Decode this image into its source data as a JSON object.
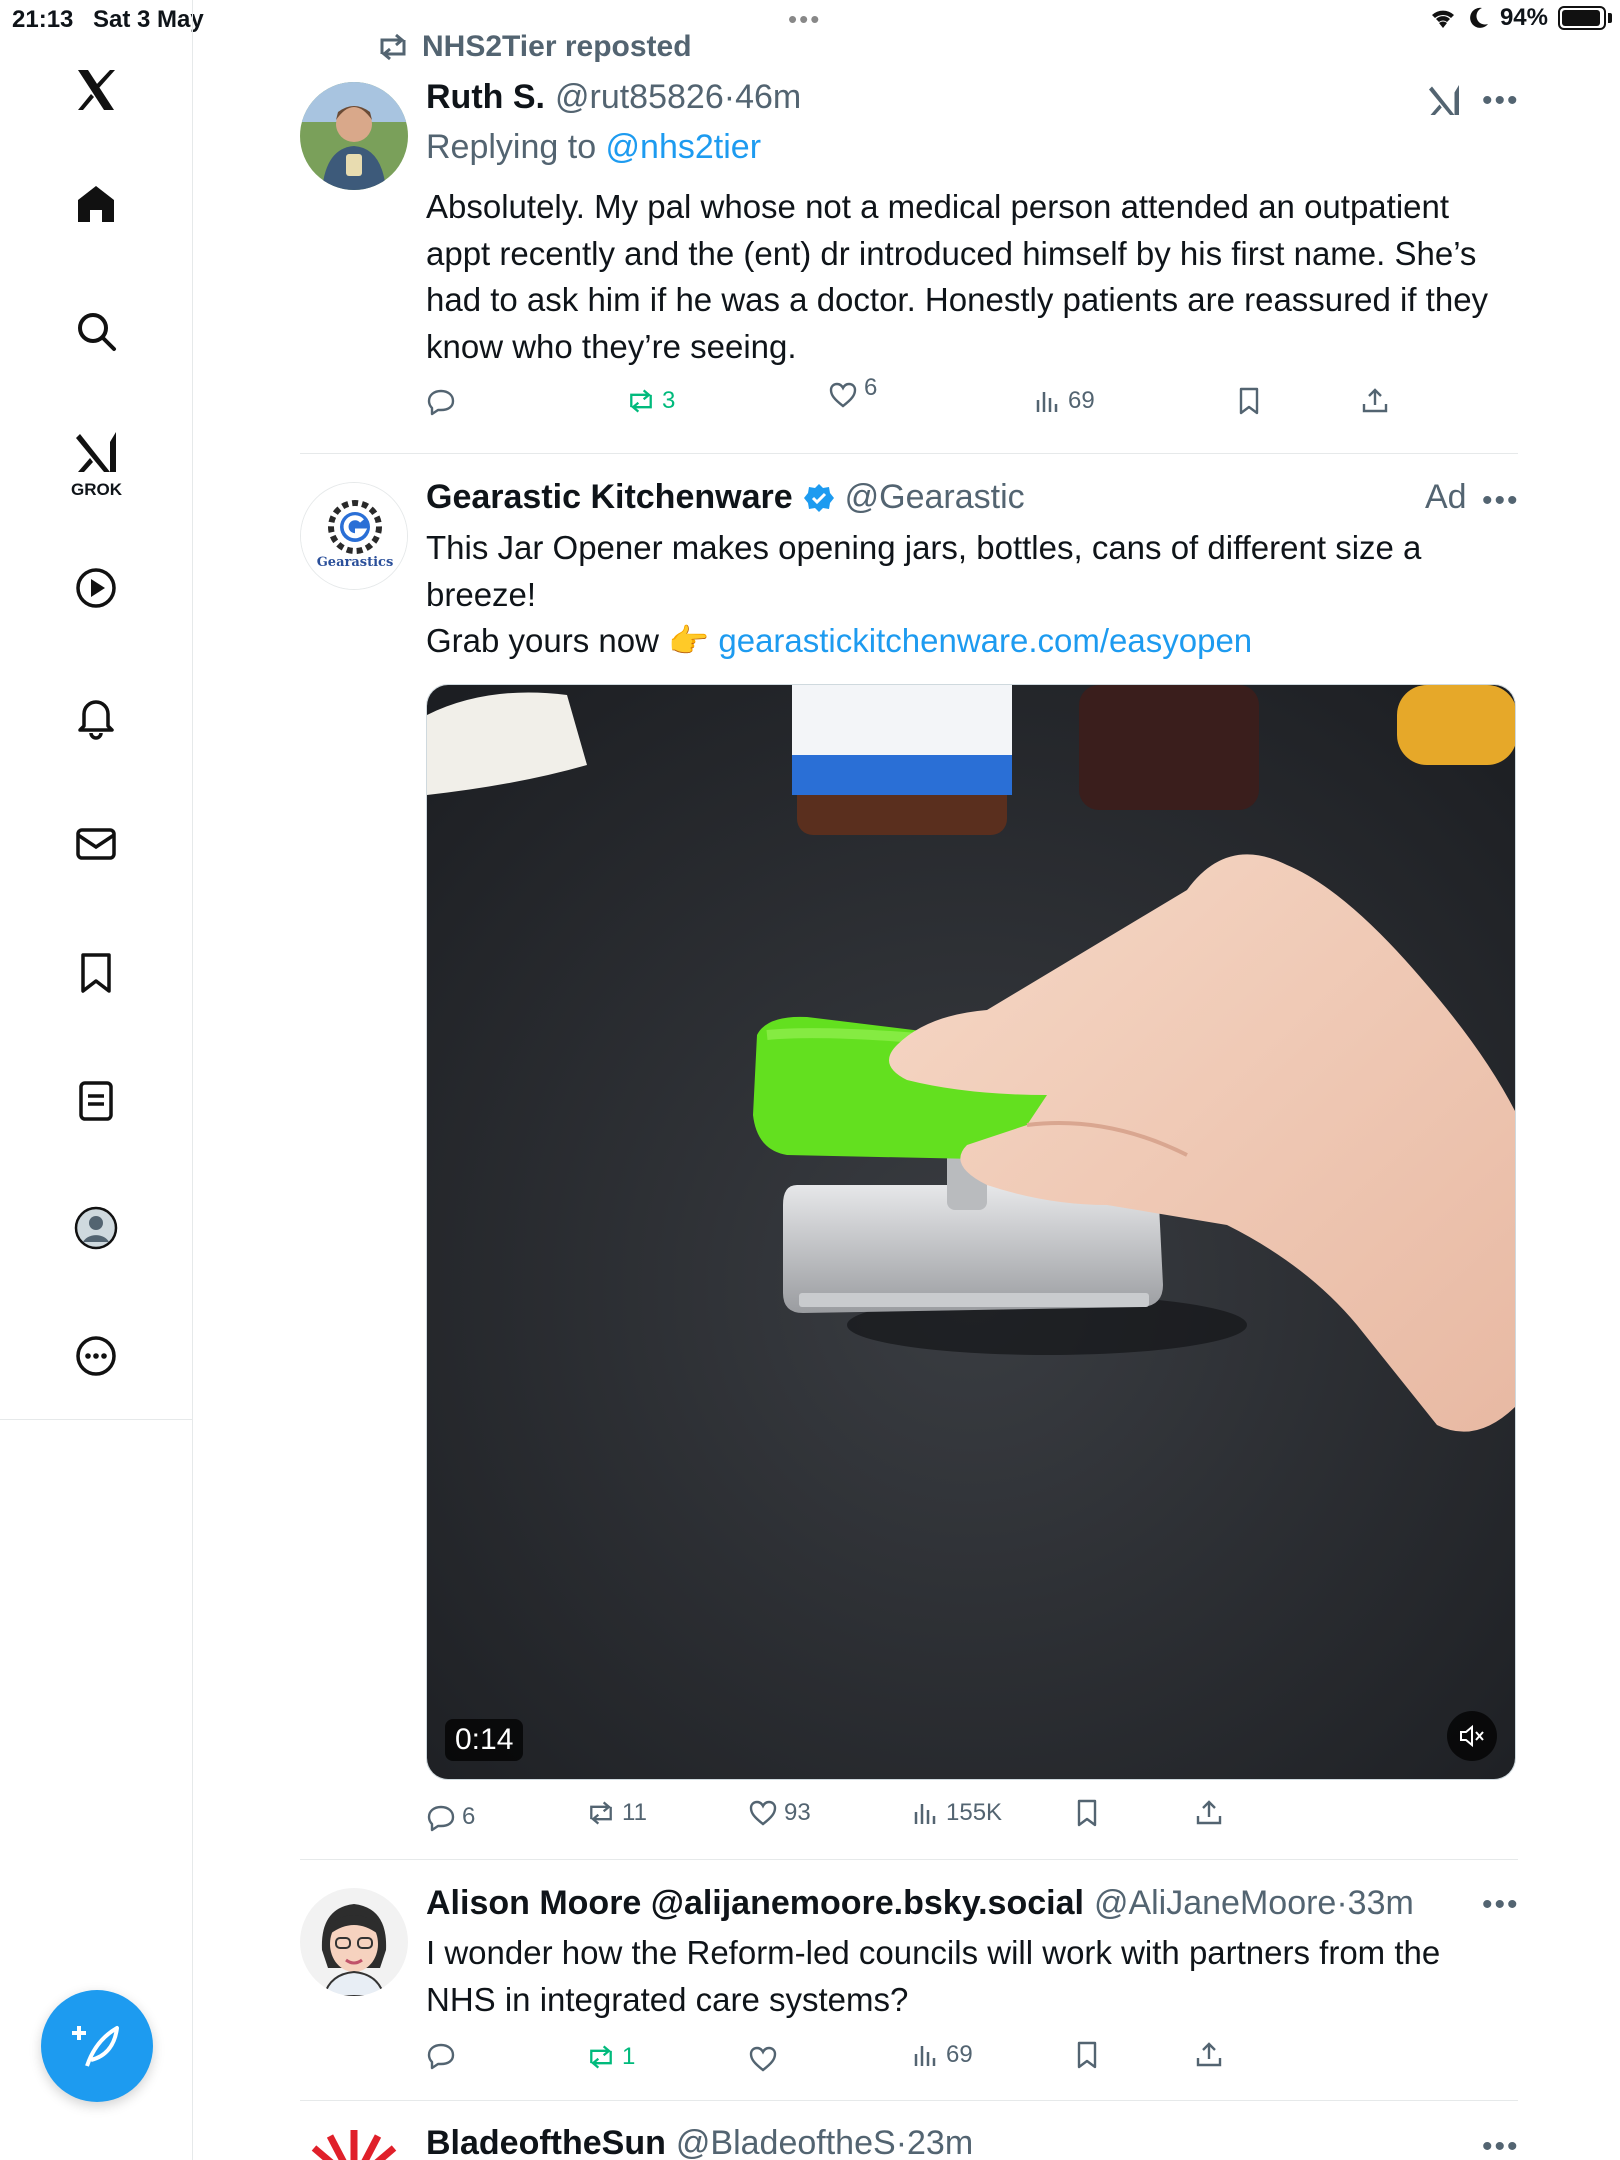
{
  "status_bar": {
    "time": "21:13",
    "date": "Sat 3 May",
    "battery": "94%",
    "top_dots": "•••"
  },
  "sidebar": {
    "items": [
      {
        "name": "x-logo-icon"
      },
      {
        "name": "home-icon"
      },
      {
        "name": "search-icon"
      },
      {
        "name": "grok-icon",
        "label": "GROK"
      },
      {
        "name": "video-icon"
      },
      {
        "name": "notifications-icon"
      },
      {
        "name": "messages-icon"
      },
      {
        "name": "bookmarks-icon"
      },
      {
        "name": "lists-icon"
      },
      {
        "name": "profile-icon"
      },
      {
        "name": "more-icon"
      }
    ],
    "compose": "compose-post-icon"
  },
  "posts": [
    {
      "repost_label": "NHS2Tier reposted",
      "display_name": "Ruth S.",
      "handle": "@rut85826",
      "dot": "·",
      "time": "46m",
      "replying_prefix": "Replying to ",
      "replying_handle": "@nhs2tier",
      "text": "Absolutely. My pal whose not a medical person attended an outpatient appt recently and the (ent) dr introduced himself by his first name. She’s had to ask him if he was a doctor. Honestly patients are reassured if they know who they’re seeing.",
      "more": "•••",
      "stats": {
        "replies": "",
        "reposts": "3",
        "likes": "6",
        "views": "69"
      }
    },
    {
      "display_name": "Gearastic Kitchenware",
      "handle": "@Gearastic",
      "ad_label": "Ad",
      "avatar_text": "Gearastics",
      "text_line1": "This Jar Opener makes opening jars, bottles, cans of different size a breeze!",
      "text_line2_prefix": "Grab yours now 👉 ",
      "text_link": "gearastickitchenware.com/easyopen",
      "more": "•••",
      "video_duration": "0:14",
      "stats": {
        "replies": "6",
        "reposts": "11",
        "likes": "93",
        "views": "155K"
      }
    },
    {
      "display_name": "Alison Moore @alijanemoore.bsky.social",
      "handle": "@AliJaneMoore",
      "dot": "·",
      "time": "33m",
      "text": "I wonder how the Reform-led councils will work with partners from the NHS in integrated care systems?",
      "more": "•••",
      "stats": {
        "replies": "",
        "reposts": "1",
        "likes": "",
        "views": "69"
      }
    },
    {
      "display_name": "BladeoftheSun",
      "handle": "@BladeoftheS",
      "dot": "·",
      "time": "23m",
      "more": "•••"
    }
  ],
  "colors": {
    "accent": "#1d9bf0",
    "repost_green": "#00ba7c",
    "muted": "#536471"
  }
}
